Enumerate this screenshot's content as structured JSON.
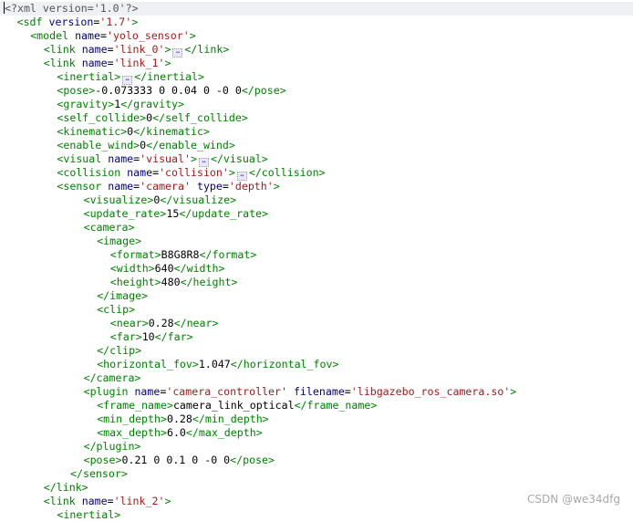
{
  "editor": {
    "lines": [
      {
        "indent": 0,
        "segments": [
          {
            "t": "pi",
            "v": "<?xml version='1.0'?>"
          }
        ],
        "highlight": true,
        "caret": true
      },
      {
        "indent": 1,
        "segments": [
          {
            "t": "tag",
            "v": "<sdf "
          },
          {
            "t": "attr",
            "v": "version"
          },
          {
            "t": "text",
            "v": "="
          },
          {
            "t": "val",
            "v": "'1.7'"
          },
          {
            "t": "tag",
            "v": ">"
          }
        ]
      },
      {
        "indent": 2,
        "segments": [
          {
            "t": "tag",
            "v": "<model "
          },
          {
            "t": "attr",
            "v": "name"
          },
          {
            "t": "text",
            "v": "="
          },
          {
            "t": "val",
            "v": "'yolo_sensor'"
          },
          {
            "t": "tag",
            "v": ">"
          }
        ]
      },
      {
        "indent": 3,
        "segments": [
          {
            "t": "tag",
            "v": "<link "
          },
          {
            "t": "attr",
            "v": "name"
          },
          {
            "t": "text",
            "v": "="
          },
          {
            "t": "val",
            "v": "'link_0'"
          },
          {
            "t": "tag",
            "v": ">"
          },
          {
            "t": "fold",
            "v": "↔"
          },
          {
            "t": "tag",
            "v": "</link>"
          }
        ]
      },
      {
        "indent": 3,
        "segments": [
          {
            "t": "tag",
            "v": "<link "
          },
          {
            "t": "attr",
            "v": "name"
          },
          {
            "t": "text",
            "v": "="
          },
          {
            "t": "val",
            "v": "'link_1'"
          },
          {
            "t": "tag",
            "v": ">"
          }
        ]
      },
      {
        "indent": 4,
        "segments": [
          {
            "t": "tag",
            "v": "<inertial>"
          },
          {
            "t": "fold",
            "v": "↔"
          },
          {
            "t": "tag",
            "v": "</inertial>"
          }
        ]
      },
      {
        "indent": 4,
        "segments": [
          {
            "t": "tag",
            "v": "<pose>"
          },
          {
            "t": "text",
            "v": "-0.073333 0 0.04 0 -0 0"
          },
          {
            "t": "tag",
            "v": "</pose>"
          }
        ]
      },
      {
        "indent": 4,
        "segments": [
          {
            "t": "tag",
            "v": "<gravity>"
          },
          {
            "t": "text",
            "v": "1"
          },
          {
            "t": "tag",
            "v": "</gravity>"
          }
        ]
      },
      {
        "indent": 4,
        "segments": [
          {
            "t": "tag",
            "v": "<self_collide>"
          },
          {
            "t": "text",
            "v": "0"
          },
          {
            "t": "tag",
            "v": "</self_collide>"
          }
        ]
      },
      {
        "indent": 4,
        "segments": [
          {
            "t": "tag",
            "v": "<kinematic>"
          },
          {
            "t": "text",
            "v": "0"
          },
          {
            "t": "tag",
            "v": "</kinematic>"
          }
        ]
      },
      {
        "indent": 4,
        "segments": [
          {
            "t": "tag",
            "v": "<enable_wind>"
          },
          {
            "t": "text",
            "v": "0"
          },
          {
            "t": "tag",
            "v": "</enable_wind>"
          }
        ]
      },
      {
        "indent": 4,
        "segments": [
          {
            "t": "tag",
            "v": "<visual "
          },
          {
            "t": "attr",
            "v": "name"
          },
          {
            "t": "text",
            "v": "="
          },
          {
            "t": "val",
            "v": "'visual'"
          },
          {
            "t": "tag",
            "v": ">"
          },
          {
            "t": "fold",
            "v": "↔"
          },
          {
            "t": "tag",
            "v": "</visual>"
          }
        ]
      },
      {
        "indent": 4,
        "segments": [
          {
            "t": "tag",
            "v": "<collision "
          },
          {
            "t": "attr",
            "v": "name"
          },
          {
            "t": "text",
            "v": "="
          },
          {
            "t": "val",
            "v": "'collision'"
          },
          {
            "t": "tag",
            "v": ">"
          },
          {
            "t": "fold",
            "v": "↔"
          },
          {
            "t": "tag",
            "v": "</collision>"
          }
        ]
      },
      {
        "indent": 4,
        "segments": [
          {
            "t": "tag",
            "v": "<sensor "
          },
          {
            "t": "attr",
            "v": "name"
          },
          {
            "t": "text",
            "v": "="
          },
          {
            "t": "val",
            "v": "'camera'"
          },
          {
            "t": "text",
            "v": " "
          },
          {
            "t": "attr",
            "v": "type"
          },
          {
            "t": "text",
            "v": "="
          },
          {
            "t": "val",
            "v": "'depth'"
          },
          {
            "t": "tag",
            "v": ">"
          }
        ]
      },
      {
        "indent": 6,
        "segments": [
          {
            "t": "tag",
            "v": "<visualize>"
          },
          {
            "t": "text",
            "v": "0"
          },
          {
            "t": "tag",
            "v": "</visualize>"
          }
        ]
      },
      {
        "indent": 6,
        "segments": [
          {
            "t": "tag",
            "v": "<update_rate>"
          },
          {
            "t": "text",
            "v": "15"
          },
          {
            "t": "tag",
            "v": "</update_rate>"
          }
        ]
      },
      {
        "indent": 6,
        "segments": [
          {
            "t": "tag",
            "v": "<camera>"
          }
        ]
      },
      {
        "indent": 7,
        "segments": [
          {
            "t": "tag",
            "v": "<image>"
          }
        ]
      },
      {
        "indent": 8,
        "segments": [
          {
            "t": "tag",
            "v": "<format>"
          },
          {
            "t": "text",
            "v": "B8G8R8"
          },
          {
            "t": "tag",
            "v": "</format>"
          }
        ]
      },
      {
        "indent": 8,
        "segments": [
          {
            "t": "tag",
            "v": "<width>"
          },
          {
            "t": "text",
            "v": "640"
          },
          {
            "t": "tag",
            "v": "</width>"
          }
        ]
      },
      {
        "indent": 8,
        "segments": [
          {
            "t": "tag",
            "v": "<height>"
          },
          {
            "t": "text",
            "v": "480"
          },
          {
            "t": "tag",
            "v": "</height>"
          }
        ]
      },
      {
        "indent": 7,
        "segments": [
          {
            "t": "tag",
            "v": "</image>"
          }
        ]
      },
      {
        "indent": 7,
        "segments": [
          {
            "t": "tag",
            "v": "<clip>"
          }
        ]
      },
      {
        "indent": 8,
        "segments": [
          {
            "t": "tag",
            "v": "<near>"
          },
          {
            "t": "text",
            "v": "0.28"
          },
          {
            "t": "tag",
            "v": "</near>"
          }
        ]
      },
      {
        "indent": 8,
        "segments": [
          {
            "t": "tag",
            "v": "<far>"
          },
          {
            "t": "text",
            "v": "10"
          },
          {
            "t": "tag",
            "v": "</far>"
          }
        ]
      },
      {
        "indent": 7,
        "segments": [
          {
            "t": "tag",
            "v": "</clip>"
          }
        ]
      },
      {
        "indent": 7,
        "segments": [
          {
            "t": "tag",
            "v": "<horizontal_fov>"
          },
          {
            "t": "text",
            "v": "1.047"
          },
          {
            "t": "tag",
            "v": "</horizontal_fov>"
          }
        ]
      },
      {
        "indent": 6,
        "segments": [
          {
            "t": "tag",
            "v": "</camera>"
          }
        ]
      },
      {
        "indent": 6,
        "segments": [
          {
            "t": "tag",
            "v": "<plugin "
          },
          {
            "t": "attr",
            "v": "name"
          },
          {
            "t": "text",
            "v": "="
          },
          {
            "t": "val",
            "v": "'camera_controller'"
          },
          {
            "t": "text",
            "v": " "
          },
          {
            "t": "attr",
            "v": "filename"
          },
          {
            "t": "text",
            "v": "="
          },
          {
            "t": "val",
            "v": "'libgazebo_ros_camera.so'"
          },
          {
            "t": "tag",
            "v": ">"
          }
        ]
      },
      {
        "indent": 7,
        "segments": [
          {
            "t": "tag",
            "v": "<frame_name>"
          },
          {
            "t": "text",
            "v": "camera_link_optical"
          },
          {
            "t": "tag",
            "v": "</frame_name>"
          }
        ]
      },
      {
        "indent": 7,
        "segments": [
          {
            "t": "tag",
            "v": "<min_depth>"
          },
          {
            "t": "text",
            "v": "0.28"
          },
          {
            "t": "tag",
            "v": "</min_depth>"
          }
        ]
      },
      {
        "indent": 7,
        "segments": [
          {
            "t": "tag",
            "v": "<max_depth>"
          },
          {
            "t": "text",
            "v": "6.0"
          },
          {
            "t": "tag",
            "v": "</max_depth>"
          }
        ]
      },
      {
        "indent": 6,
        "segments": [
          {
            "t": "tag",
            "v": "</plugin>"
          }
        ]
      },
      {
        "indent": 6,
        "segments": [
          {
            "t": "tag",
            "v": "<pose>"
          },
          {
            "t": "text",
            "v": "0.21 0 0.1 0 -0 0"
          },
          {
            "t": "tag",
            "v": "</pose>"
          }
        ]
      },
      {
        "indent": 5,
        "segments": [
          {
            "t": "tag",
            "v": "</sensor>"
          }
        ]
      },
      {
        "indent": 3,
        "segments": [
          {
            "t": "tag",
            "v": "</link>"
          }
        ]
      },
      {
        "indent": 3,
        "segments": [
          {
            "t": "tag",
            "v": "<link "
          },
          {
            "t": "attr",
            "v": "name"
          },
          {
            "t": "text",
            "v": "="
          },
          {
            "t": "val",
            "v": "'link_2'"
          },
          {
            "t": "tag",
            "v": ">"
          }
        ]
      },
      {
        "indent": 4,
        "segments": [
          {
            "t": "tag",
            "v": "<inertial>"
          }
        ]
      }
    ]
  },
  "watermark": {
    "text": "CSDN @we34dfg"
  }
}
